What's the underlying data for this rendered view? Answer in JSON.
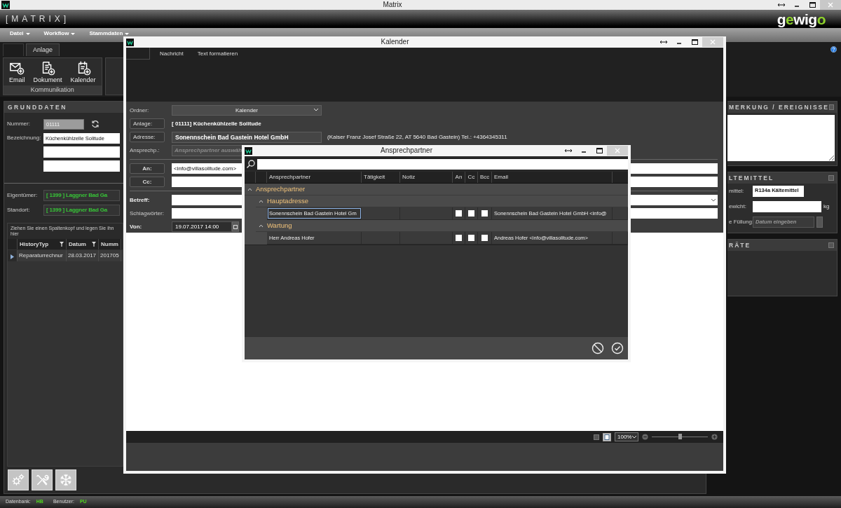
{
  "window": {
    "title": "Matrix"
  },
  "app_header": {
    "logo": "[MATRIX]",
    "brand": "gewigo"
  },
  "menu": [
    {
      "label": "Datei"
    },
    {
      "label": "Workflow"
    },
    {
      "label": "Stammdaten"
    }
  ],
  "ribbon": {
    "tabs": [
      {
        "label": "Anlage",
        "selected": true
      }
    ],
    "groups": [
      {
        "label": "Kommunikation",
        "buttons": [
          {
            "label": "Email",
            "kind": "mail"
          },
          {
            "label": "Dokument",
            "kind": "document"
          },
          {
            "label": "Kalender",
            "kind": "calendar"
          }
        ]
      }
    ]
  },
  "grunddaten": {
    "title": "GRUNDDATEN",
    "nummer": {
      "label": "Nummer:",
      "value": "01111"
    },
    "bezeichnung": {
      "label": "Bezeichnung:",
      "value": "Küchenkühlzelle Solitude"
    },
    "eigentuemer": {
      "label": "Eigentümer:",
      "value": "[ 1399 ] Laggner Bad Ga"
    },
    "standort": {
      "label": "Standort:",
      "value": "[ 1399 ] Laggner Bad Ga"
    }
  },
  "history_grid": {
    "hint": "Ziehen Sie einen Spaltenkopf und legen Sie ihn hier",
    "columns": [
      {
        "label": "HistoryTyp",
        "filter": true
      },
      {
        "label": "Datum",
        "filter": true
      },
      {
        "label": "Numm"
      }
    ],
    "rows": [
      {
        "cells": [
          "Reparaturrechnur",
          "28.03.2017",
          "201705"
        ],
        "selected": true
      }
    ]
  },
  "tool_buttons": [
    {
      "kind": "gears"
    },
    {
      "kind": "tools"
    },
    {
      "kind": "snowflake"
    }
  ],
  "side_panels": [
    {
      "title": "MERKUNG / EREIGNISSE",
      "kind": "notes"
    },
    {
      "title": "LTEMITTEL",
      "kind": "form",
      "fields": [
        {
          "label": "mittel:",
          "kind": "text",
          "value": "R134a Kältemittel"
        },
        {
          "label": "ewicht:",
          "kind": "unit",
          "unit": "kg"
        },
        {
          "label": "e Füllung:",
          "kind": "date",
          "placeholder": "Datum eingeben"
        }
      ]
    },
    {
      "title": "RÄTE",
      "kind": "empty"
    }
  ],
  "status_bar": [
    {
      "label": "Datenbank:",
      "value": "HB"
    },
    {
      "label": "Benutzer:",
      "value": "PU"
    }
  ],
  "kalender": {
    "title": "Kalender",
    "tabs": [
      {
        "label": "Nachricht",
        "selected": false
      },
      {
        "label": "Text formatieren",
        "selected": false
      }
    ],
    "ordner": {
      "label": "Ordner:",
      "value": "Kalender"
    },
    "anlage": {
      "label": "Anlage:",
      "value": "[ 01111] Küchenkühlzelle Solitude"
    },
    "adresse": {
      "label": "Adresse:",
      "value": "Sonennschein Bad Gastein Hotel GmbH",
      "detail": "(Kaiser Franz Josef Straße 22, AT 5640 Bad Gastein) Tel.: +4364345311"
    },
    "ansprechpartner": {
      "label": "Ansprechp.:",
      "placeholder": "Ansprechpartner auswäh"
    },
    "an": {
      "label": "An:",
      "value": "<info@villasolitude.com>"
    },
    "cc": {
      "label": "Cc:"
    },
    "betreff": {
      "label": "Betreff:"
    },
    "schlagwoerter": {
      "label": "Schlagwörter:"
    },
    "von": {
      "label": "Von:",
      "value": "19.07.2017 14:00"
    },
    "zoom": {
      "reading": "100%",
      "level": 0.5
    }
  },
  "dialog": {
    "title": "Ansprechpartner",
    "columns": [
      "Ansprechpartner",
      "Tätigkeit",
      "Notiz",
      "An",
      "Cc",
      "Bcc",
      "Email"
    ],
    "groups": [
      {
        "label": "Ansprechpartner",
        "expanded": true,
        "children": [
          {
            "label": "Hauptadresse",
            "expanded": true,
            "rows": [
              {
                "name": "Sonennschein Bad Gastein Hotel Gm",
                "email": "Sonennschein Bad Gastein Hotel GmbH <info@",
                "an": false,
                "cc": false,
                "bcc": false,
                "selected": true
              }
            ]
          },
          {
            "label": "Wartung",
            "expanded": true,
            "rows": [
              {
                "name": "Herr Andreas Hofer",
                "email": "Andreas Hofer <info@villasolitude.com>",
                "an": false,
                "cc": false,
                "bcc": false,
                "selected": false
              }
            ]
          }
        ]
      }
    ]
  }
}
